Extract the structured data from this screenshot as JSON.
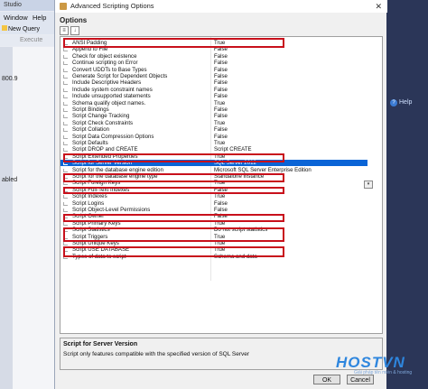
{
  "background": {
    "title": "Studio",
    "menu": [
      "Window",
      "Help"
    ],
    "toolbar": [
      "New Query"
    ],
    "execute": "Execute",
    "side_value": "800.9",
    "side_text": "abled",
    "help": "Help"
  },
  "dialog": {
    "title": "Advanced Scripting Options",
    "close": "✕",
    "section": "Options",
    "rows": [
      {
        "label": "ANSI Padding",
        "value": "True"
      },
      {
        "label": "Append to File",
        "value": "False"
      },
      {
        "label": "Check for object existence",
        "value": "False"
      },
      {
        "label": "Continue scripting on Error",
        "value": "False"
      },
      {
        "label": "Convert UDDTs to Base Types",
        "value": "False"
      },
      {
        "label": "Generate Script for Dependent Objects",
        "value": "False"
      },
      {
        "label": "Include Descriptive Headers",
        "value": "False"
      },
      {
        "label": "Include system constraint names",
        "value": "False"
      },
      {
        "label": "Include unsupported statements",
        "value": "False"
      },
      {
        "label": "Schema qualify object names.",
        "value": "True"
      },
      {
        "label": "Script Bindings",
        "value": "False"
      },
      {
        "label": "Script Change Tracking",
        "value": "False"
      },
      {
        "label": "Script Check Constraints",
        "value": "True"
      },
      {
        "label": "Script Collation",
        "value": "False"
      },
      {
        "label": "Script Data Compression Options",
        "value": "False"
      },
      {
        "label": "Script Defaults",
        "value": "True"
      },
      {
        "label": "Script DROP and CREATE",
        "value": "Script CREATE"
      },
      {
        "label": "Script Extended Properties",
        "value": "True"
      },
      {
        "label": "Script for Server Version",
        "value": "SQL Server 2012"
      },
      {
        "label": "Script for the database engine edition",
        "value": "Microsoft SQL Server Enterprise Edition"
      },
      {
        "label": "Script for the database engine type",
        "value": "Standalone instance"
      },
      {
        "label": "Script Foreign Keys",
        "value": "True"
      },
      {
        "label": "Script Full-Text Indexes",
        "value": "False"
      },
      {
        "label": "Script Indexes",
        "value": "True"
      },
      {
        "label": "Script Logins",
        "value": "False"
      },
      {
        "label": "Script Object-Level Permissions",
        "value": "False"
      },
      {
        "label": "Script Owner",
        "value": "False"
      },
      {
        "label": "Script Primary Keys",
        "value": "True"
      },
      {
        "label": "Script Statistics",
        "value": "Do not script statistics"
      },
      {
        "label": "Script Triggers",
        "value": "True"
      },
      {
        "label": "Script Unique Keys",
        "value": "True"
      },
      {
        "label": "Script USE DATABASE",
        "value": "True"
      },
      {
        "label": "Types of data to script",
        "value": "Schema and data"
      }
    ],
    "selected_index": 18,
    "description_title": "Script for Server Version",
    "description_text": "Script only features compatible with the specified version of SQL Server",
    "ok": "OK",
    "cancel": "Cancel",
    "highlight_color": "#c8101b"
  },
  "watermark": {
    "brand": "HOSTVN",
    "sub": "Giải pháp tên miền & hosting"
  }
}
